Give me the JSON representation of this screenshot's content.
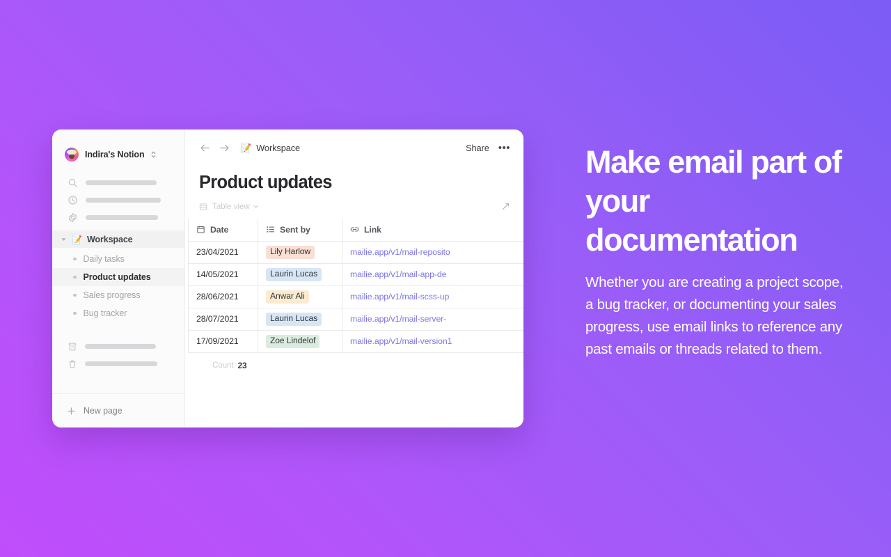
{
  "sidebar": {
    "workspace_name": "Indira's Notion",
    "avatar_name": "user-avatar",
    "switcher_icon": "updown-chevron-icon",
    "quick_links": [
      {
        "icon": "search-icon",
        "placeholder_bar": true
      },
      {
        "icon": "clock-icon",
        "placeholder_bar": true
      },
      {
        "icon": "gear-icon",
        "placeholder_bar": true
      }
    ],
    "workspace_row": {
      "toggle_icon": "triangle-down-icon",
      "emoji": "📝",
      "label": "Workspace"
    },
    "pages": [
      {
        "label": "Daily tasks",
        "active": false
      },
      {
        "label": "Product updates",
        "active": true
      },
      {
        "label": "Sales progress",
        "active": false
      },
      {
        "label": "Bug tracker",
        "active": false
      }
    ],
    "utils": [
      {
        "icon": "archive-icon",
        "placeholder_bar": true
      },
      {
        "icon": "trash-icon",
        "placeholder_bar": true
      }
    ],
    "new_page_label": "New page",
    "new_page_icon": "plus-icon"
  },
  "topbar": {
    "back_icon": "arrow-left-icon",
    "forward_icon": "arrow-right-icon",
    "breadcrumb_emoji": "📝",
    "breadcrumb_label": "Workspace",
    "share_label": "Share",
    "more_label": "•••"
  },
  "page": {
    "title": "Product updates",
    "view_icon": "table-icon",
    "view_label": "Table view",
    "view_chevron_icon": "chevron-down-icon",
    "expand_icon": "expand-diagonal-icon"
  },
  "table": {
    "columns": [
      {
        "label": "Date",
        "icon": "calendar-icon"
      },
      {
        "label": "Sent by",
        "icon": "multi-select-icon"
      },
      {
        "label": "Link",
        "icon": "link-icon"
      }
    ],
    "rows": [
      {
        "date": "23/04/2021",
        "sent_by": "Lily Harlow",
        "chip_color": "#fadfd3",
        "link": "mailie.app/v1/mail-reposito"
      },
      {
        "date": "14/05/2021",
        "sent_by": "Laurin Lucas",
        "chip_color": "#d7e6f5",
        "link": "mailie.app/v1/mail-app-de"
      },
      {
        "date": "28/06/2021",
        "sent_by": "Anwar Ali",
        "chip_color": "#fbeccf",
        "link": "mailie.app/v1/mail-scss-up"
      },
      {
        "date": "28/07/2021",
        "sent_by": "Laurin Lucas",
        "chip_color": "#d7e6f5",
        "link": "mailie.app/v1/mail-server-"
      },
      {
        "date": "17/09/2021",
        "sent_by": "Zoe Lindelof",
        "chip_color": "#d9ecdf",
        "link": "mailie.app/v1/mail-version1"
      }
    ],
    "footer": {
      "count_label": "Count",
      "count_value": "23"
    }
  },
  "promo": {
    "headline": "Make email part of your documentation",
    "body": "Whether you are creating a project scope, a bug tracker, or documenting your sales progress, use email links to reference any past emails or threads related to them."
  },
  "colors": {
    "background_start": "#c04dfb",
    "background_end": "#7b5cf5",
    "link": "#7b77e8",
    "card": "#ffffff"
  }
}
